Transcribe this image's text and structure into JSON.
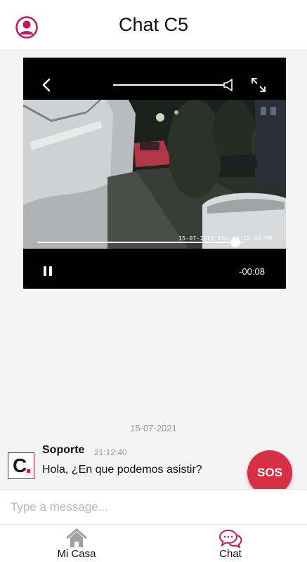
{
  "header": {
    "title": "Chat C5"
  },
  "player": {
    "video_timestamp": "15-07-2021 Thu 10:12:42 PM",
    "time_remaining": "-00:08",
    "progress_fraction": 0.95,
    "state": "playing"
  },
  "chat": {
    "date_separator": "15-07-2021",
    "messages": [
      {
        "sender": "Soporte",
        "time": "21:12:40",
        "text": "Hola, ¿En que podemos asistir?"
      }
    ]
  },
  "sos": {
    "label": "SOS"
  },
  "composer": {
    "placeholder": "Type a message..."
  },
  "nav": {
    "items": [
      {
        "label": "Mi Casa",
        "icon": "home-icon",
        "active": false
      },
      {
        "label": "Chat",
        "icon": "chat-bubbles-icon",
        "active": true
      }
    ]
  },
  "colors": {
    "accent": "#c2185b",
    "sos": "#d92f44",
    "inactive_icon": "#a0a0a0"
  }
}
